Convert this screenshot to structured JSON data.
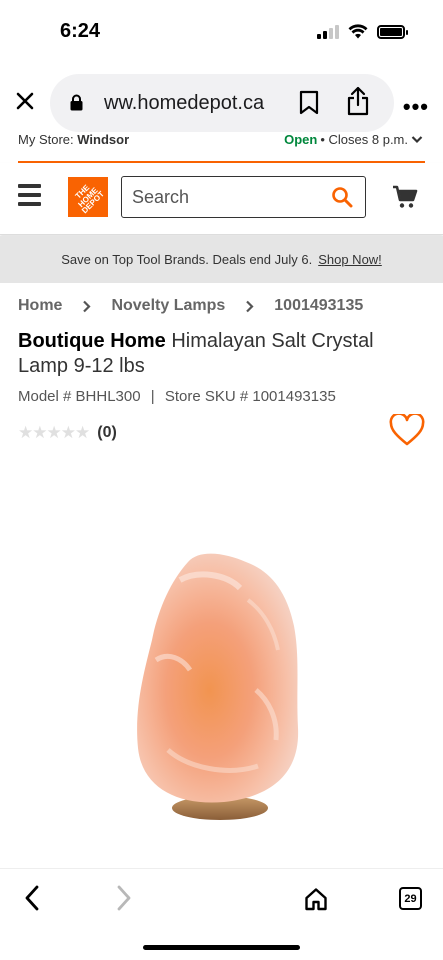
{
  "status_bar": {
    "time": "6:24"
  },
  "browser": {
    "url": "ww.homedepot.ca",
    "tab_count": "29",
    "more_label": "•••"
  },
  "store": {
    "label": "My Store:",
    "name": "Windsor",
    "open": "Open",
    "closes": "• Closes 8 p.m."
  },
  "header": {
    "logo_text": "THE HOME DEPOT",
    "search_placeholder": "Search"
  },
  "promo": {
    "text": "Save on Top Tool Brands. Deals end July 6.",
    "link": "Shop Now!"
  },
  "breadcrumb": [
    "Home",
    "Novelty Lamps",
    "1001493135"
  ],
  "product": {
    "brand": "Boutique Home",
    "name": "Himalayan Salt Crystal Lamp 9-12 lbs",
    "model": "Model # BHHL300",
    "sku": "Store SKU # 1001493135",
    "divider": "|",
    "rating": 0,
    "review_count": "(0)"
  },
  "icons": [
    "close-icon",
    "lock-icon",
    "bookmark-icon",
    "share-icon",
    "more-icon",
    "menu-icon",
    "search-icon",
    "cart-icon",
    "heart-icon",
    "back-icon",
    "forward-icon",
    "home-icon",
    "tabs-icon"
  ],
  "colors": {
    "brand": "#f96302",
    "open": "#00873c"
  }
}
